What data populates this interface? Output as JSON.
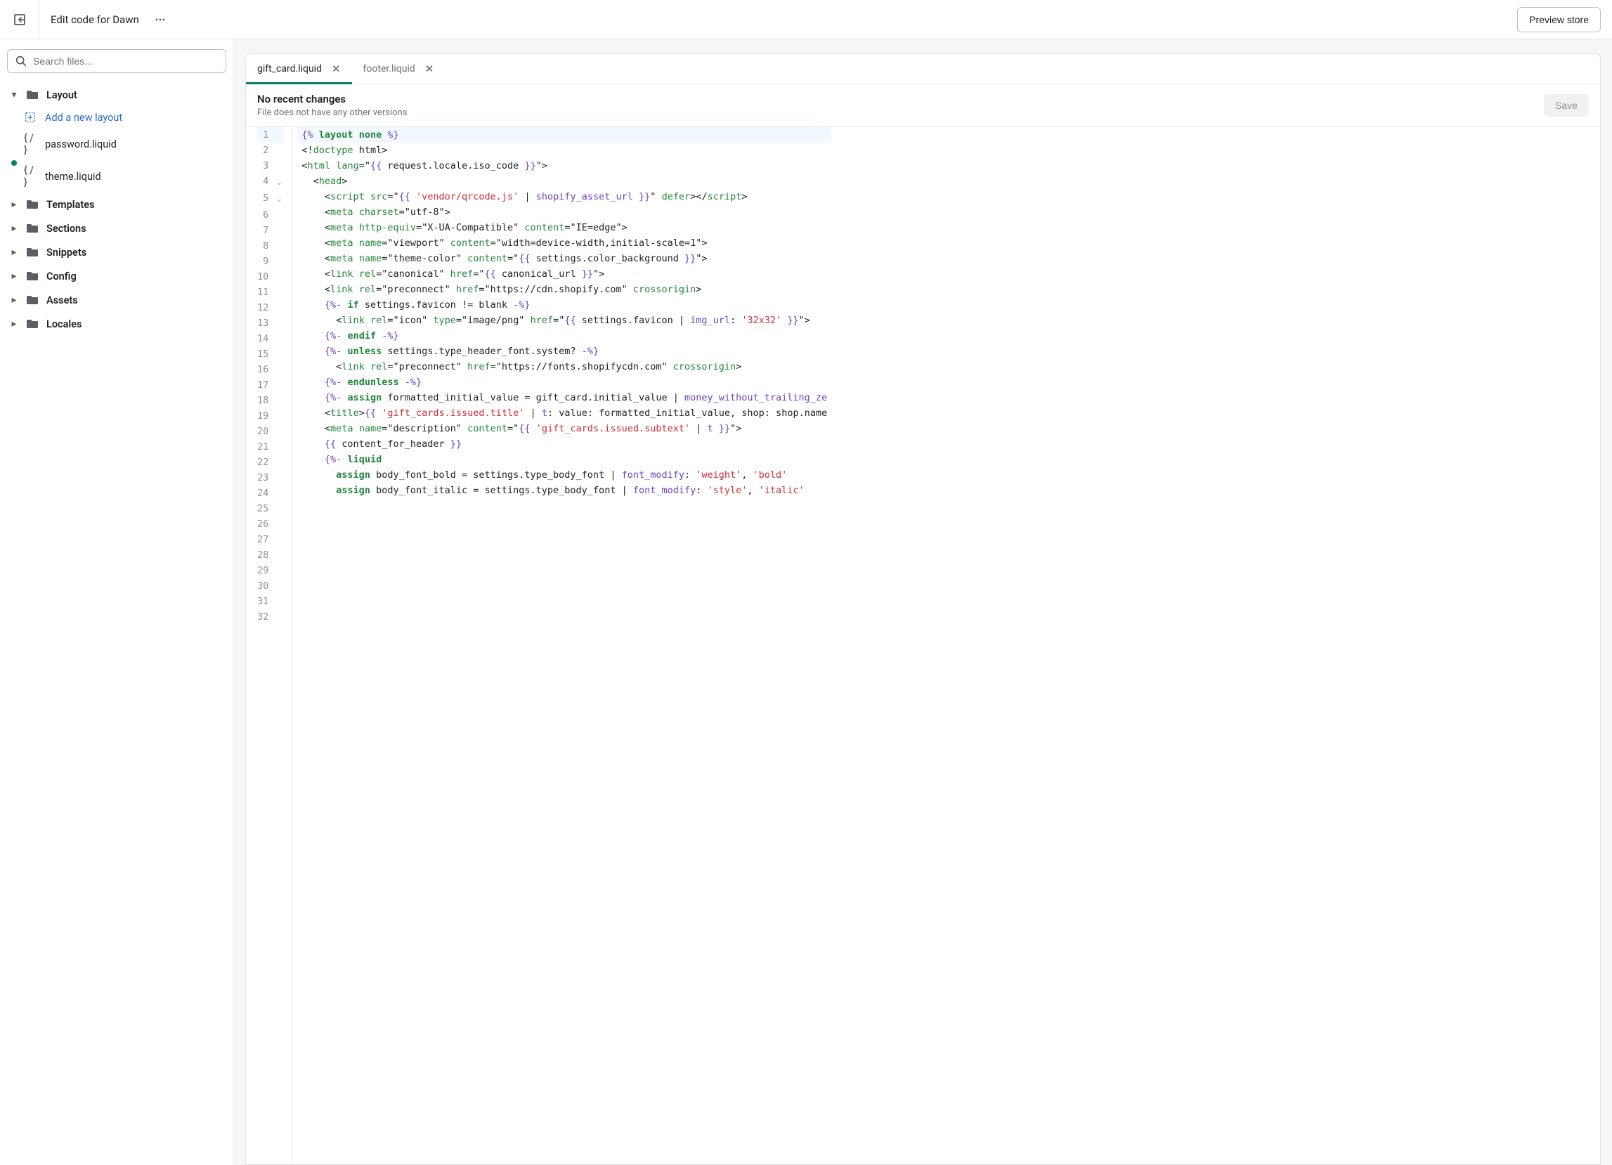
{
  "header": {
    "title": "Edit code for Dawn",
    "preview_label": "Preview store"
  },
  "sidebar": {
    "search_placeholder": "Search files...",
    "groups": [
      {
        "name": "Layout",
        "expanded": true
      },
      {
        "name": "Templates",
        "expanded": false
      },
      {
        "name": "Sections",
        "expanded": false
      },
      {
        "name": "Snippets",
        "expanded": false
      },
      {
        "name": "Config",
        "expanded": false
      },
      {
        "name": "Assets",
        "expanded": false
      },
      {
        "name": "Locales",
        "expanded": false
      }
    ],
    "layout_add_label": "Add a new layout",
    "layout_files": [
      {
        "name": "password.liquid",
        "unsaved": false
      },
      {
        "name": "theme.liquid",
        "unsaved": true
      }
    ]
  },
  "tabs": [
    {
      "label": "gift_card.liquid",
      "active": true
    },
    {
      "label": "footer.liquid",
      "active": false
    }
  ],
  "status": {
    "title": "No recent changes",
    "subtitle": "File does not have any other versions",
    "save_label": "Save"
  },
  "code": {
    "lines": [
      "{% layout none %}",
      "",
      "<!doctype html>",
      "<html lang=\"{{ request.locale.iso_code }}\">",
      "  <head>",
      "    <script src=\"{{ 'vendor/qrcode.js' | shopify_asset_url }}\" defer></\\u0073cript>",
      "    <meta charset=\"utf-8\">",
      "    <meta http-equiv=\"X-UA-Compatible\" content=\"IE=edge\">",
      "    <meta name=\"viewport\" content=\"width=device-width,initial-scale=1\">",
      "    <meta name=\"theme-color\" content=\"{{ settings.color_background }}\">",
      "    <link rel=\"canonical\" href=\"{{ canonical_url }}\">",
      "    <link rel=\"preconnect\" href=\"https://cdn.shopify.com\" crossorigin>",
      "",
      "    {%- if settings.favicon != blank -%}",
      "      <link rel=\"icon\" type=\"image/png\" href=\"{{ settings.favicon | img_url: '32x32' }}\">",
      "    {%- endif -%}",
      "",
      "    {%- unless settings.type_header_font.system? -%}",
      "      <link rel=\"preconnect\" href=\"https://fonts.shopifycdn.com\" crossorigin>",
      "    {%- endunless -%}",
      "",
      "    {%- assign formatted_initial_value = gift_card.initial_value | money_without_trailing_ze",
      "",
      "    <title>{{ 'gift_cards.issued.title' | t: value: formatted_initial_value, shop: shop.name",
      "",
      "    <meta name=\"description\" content=\"{{ 'gift_cards.issued.subtext' | t }}\">",
      "",
      "    {{ content_for_header }}",
      "",
      "    {%- liquid",
      "      assign body_font_bold = settings.type_body_font | font_modify: 'weight', 'bold'",
      "      assign body_font_italic = settings.type_body_font | font_modify: 'style', 'italic'"
    ],
    "fold_lines": [
      4,
      5
    ]
  }
}
